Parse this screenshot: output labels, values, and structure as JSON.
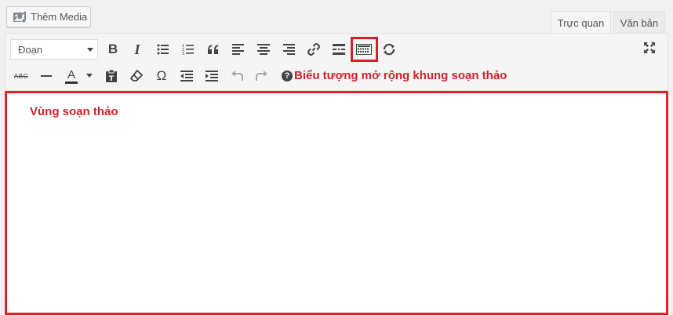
{
  "media_button": {
    "label": "Thêm Media",
    "icon": "add-media-icon"
  },
  "tabs": [
    {
      "label": "Trực quan",
      "active": true
    },
    {
      "label": "Văn bản",
      "active": false
    }
  ],
  "toolbar": {
    "format_select": {
      "value": "Đoạn"
    },
    "row1_icons": [
      "bold-icon",
      "italic-icon",
      "bullet-list-icon",
      "numbered-list-icon",
      "blockquote-icon",
      "align-left-icon",
      "align-center-icon",
      "align-right-icon",
      "link-icon",
      "read-more-icon",
      "toolbar-toggle-icon",
      "refresh-icon"
    ],
    "fullscreen_icon": "fullscreen-icon",
    "row2_icons": [
      "strikethrough-icon",
      "horizontal-line-icon",
      "text-color-icon",
      "paste-text-icon",
      "clear-formatting-icon",
      "special-character-icon",
      "outdent-icon",
      "indent-icon",
      "undo-icon",
      "redo-icon",
      "help-icon"
    ],
    "text_color_letter": "A",
    "strikethrough_text": "ABC",
    "special_character_glyph": "Ω"
  },
  "annotations": {
    "toolbar_toggle": "Biểu tượng mở rộng khung soạn thảo",
    "editor_area": "Vùng soạn thảo"
  },
  "colors": {
    "highlight": "#d1222b",
    "toolbar_bg": "#f5f5f5",
    "editor_bg": "#ffffff"
  }
}
